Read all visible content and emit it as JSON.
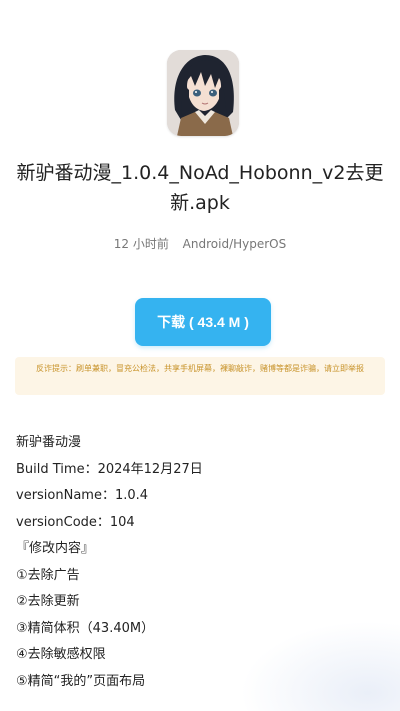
{
  "app": {
    "icon_name": "anime-character-app-icon",
    "file_name": "新驴番动漫_1.0.4_NoAd_Hobonn_v2去更新.apk",
    "time_ago": "12 小时前",
    "platform": "Android/HyperOS"
  },
  "download": {
    "label": "下载 ( 43.4 M )"
  },
  "fraud_warning": {
    "text": "反诈提示：刷单兼职，冒充公检法，共享手机屏幕，裸聊敲诈，赌博等都是诈骗，请立即举报"
  },
  "description": {
    "lines": [
      "新驴番动漫",
      "Build Time：2024年12月27日",
      "versionName：1.0.4",
      "versionCode：104",
      "『修改内容』",
      "①去除广告",
      "②去除更新",
      "③精简体积（43.40M）",
      "④去除敏感权限",
      "⑤精简“我的”页面布局"
    ]
  },
  "colors": {
    "accent": "#35b3f0",
    "warning_bg": "#fdf5e6",
    "warning_text": "#c8932a"
  }
}
